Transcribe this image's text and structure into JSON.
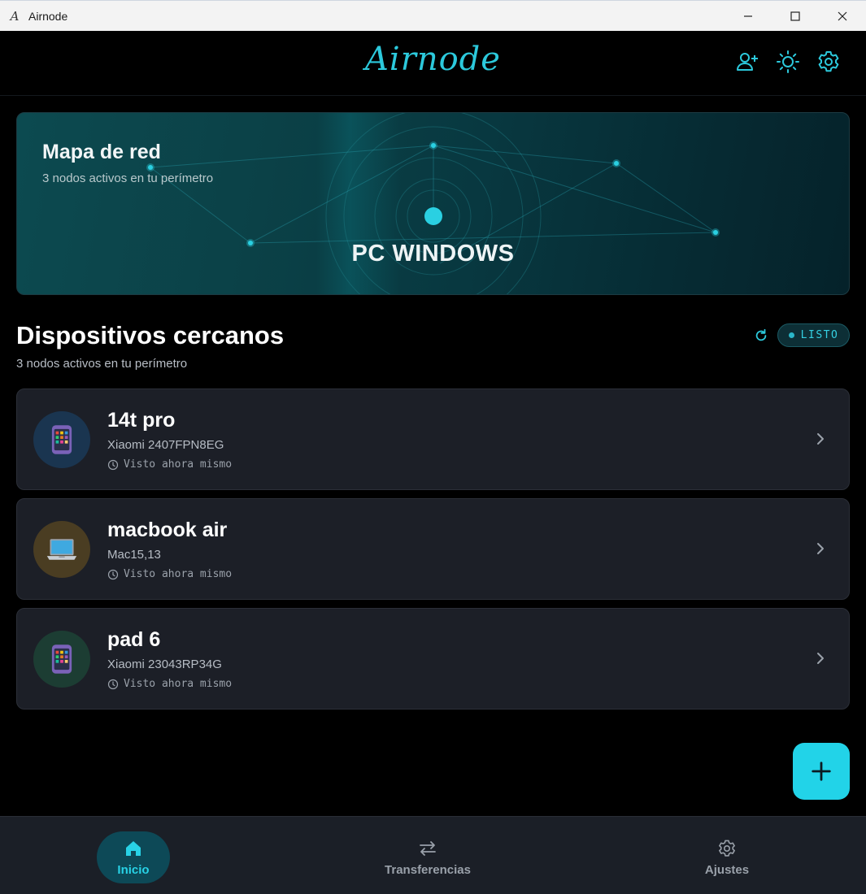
{
  "window": {
    "title": "Airnode",
    "controls": [
      "minimize",
      "maximize",
      "close"
    ]
  },
  "header": {
    "brand": "Airnode",
    "actions": [
      "add-user-icon",
      "sun-icon",
      "gear-icon"
    ]
  },
  "network_map": {
    "title": "Mapa de red",
    "subtitle": "3 nodos activos en tu perímetro",
    "center_label": "PC WINDOWS"
  },
  "devices_section": {
    "title": "Dispositivos cercanos",
    "subtitle": "3 nodos activos en tu perímetro",
    "status_label": "LISTO"
  },
  "devices": [
    {
      "name": "14t pro",
      "model": "Xiaomi 2407FPN8EG",
      "last_seen": "Visto ahora mismo",
      "icon": "phone-icon",
      "avatar_color": "#1a3550"
    },
    {
      "name": "macbook air",
      "model": "Mac15,13",
      "last_seen": "Visto ahora mismo",
      "icon": "laptop-icon",
      "avatar_color": "#4a3d22"
    },
    {
      "name": "pad 6",
      "model": "Xiaomi 23043RP34G",
      "last_seen": "Visto ahora mismo",
      "icon": "phone-icon",
      "avatar_color": "#1c3d33"
    }
  ],
  "fab": {
    "icon": "plus-icon"
  },
  "bottom_nav": [
    {
      "label": "Inicio",
      "icon": "home-icon",
      "active": true
    },
    {
      "label": "Transferencias",
      "icon": "transfer-icon",
      "active": false
    },
    {
      "label": "Ajustes",
      "icon": "gear-icon",
      "active": false
    }
  ],
  "colors": {
    "accent": "#22d3e8",
    "background": "#000000",
    "card": "#1c1f27"
  }
}
